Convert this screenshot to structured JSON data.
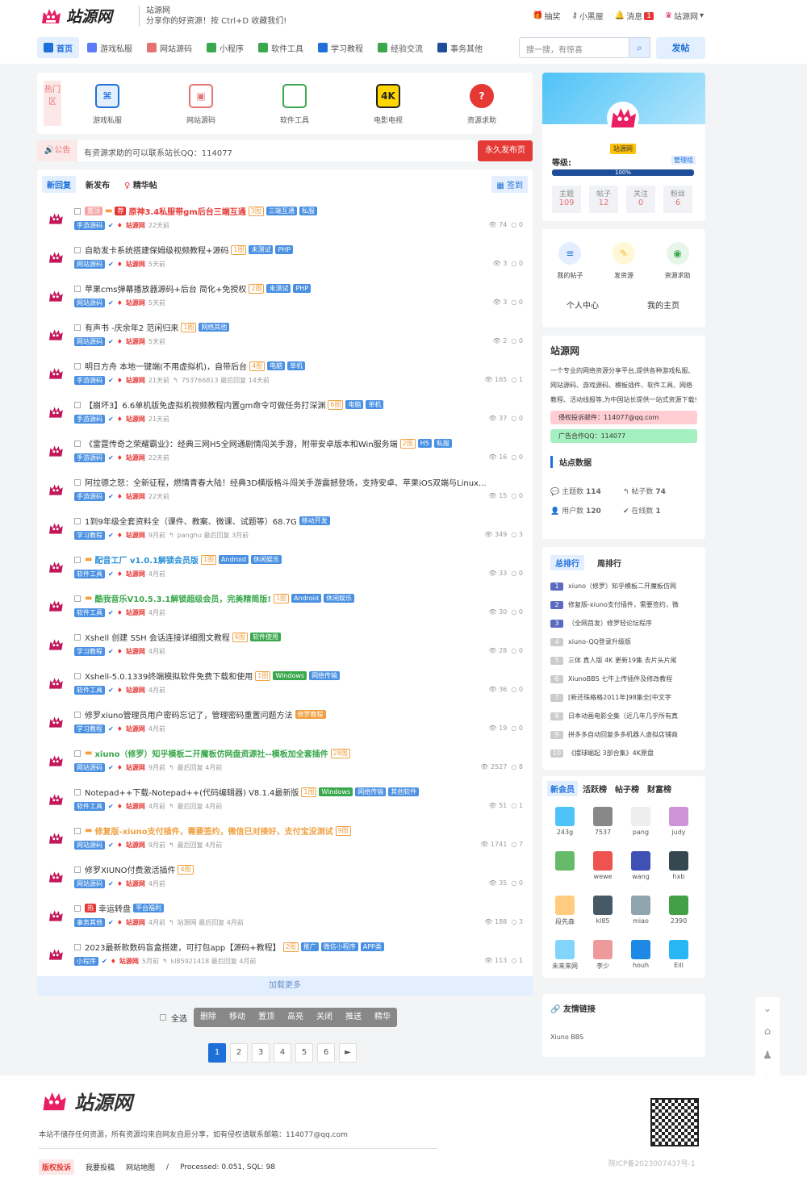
{
  "site": {
    "name": "站源网",
    "sub_name": "站源网",
    "slogan": "分享你的好资源！按 Ctrl+D 收藏我们!"
  },
  "top_links": {
    "lottery": "抽奖",
    "blackroom": "小黑屋",
    "messages": "消息",
    "msg_count": "1",
    "user": "站源网"
  },
  "nav": [
    "首页",
    "游戏私服",
    "网站源码",
    "小程序",
    "软件工具",
    "学习教程",
    "经验交流",
    "事务其他"
  ],
  "search": {
    "placeholder": "搜一搜，有惊喜"
  },
  "post_btn": "发帖",
  "hot": {
    "tag": "热门区",
    "items": [
      {
        "label": "游戏私服",
        "icon": "gamepad-icon"
      },
      {
        "label": "网站源码",
        "icon": "web-code-icon"
      },
      {
        "label": "软件工具",
        "icon": "code-icon"
      },
      {
        "label": "电影电视",
        "icon": "4k-icon"
      },
      {
        "label": "资源求助",
        "icon": "question-icon"
      }
    ]
  },
  "notice": {
    "tag": "公告",
    "text": "有资源求助的可以联系站长QQ：114077",
    "btn": "永久发布页"
  },
  "tabs": [
    "新回复",
    "新发布",
    "精华帖"
  ],
  "signin": "签到",
  "threads": [
    {
      "title": "原神3.4私服带gm后台三端互通",
      "pages": "3图",
      "tags": [
        "三端互通",
        "私服"
      ],
      "cat": "手游源码",
      "author": "站源网",
      "time": "22天前",
      "views": "74",
      "replies": "0",
      "red": true,
      "top": "置顶"
    },
    {
      "title": "自助发卡系统搭建保姆级视频教程+源码",
      "pages": "1图",
      "tags": [
        "未测试",
        "PHP"
      ],
      "cat": "网站源码",
      "author": "站源网",
      "time": "5天前",
      "views": "3",
      "replies": "0"
    },
    {
      "title": "苹果cms弹幕播放器源码+后台 简化+免授权",
      "pages": "2图",
      "tags": [
        "未测试",
        "PHP"
      ],
      "cat": "网站源码",
      "author": "站源网",
      "time": "5天前",
      "views": "3",
      "replies": "0"
    },
    {
      "title": "有声书 -庆余年2 范闲归来",
      "pages": "1图",
      "tags": [
        "网络其他"
      ],
      "cat": "网站源码",
      "author": "站源网",
      "time": "5天前",
      "views": "2",
      "replies": "0"
    },
    {
      "title": "明日方舟 本地一键端(不用虚拟机)，自带后台",
      "pages": "4图",
      "tags": [
        "电脑",
        "单机"
      ],
      "cat": "手游源码",
      "author": "站源网",
      "time": "21天前",
      "extra": "753766813  最后回复 14天前",
      "views": "165",
      "replies": "1"
    },
    {
      "title": "【崩坏3】6.6单机版免虚拟机视频教程内置gm命令可做任务打深渊",
      "pages": "6图",
      "tags": [
        "电脑",
        "单机"
      ],
      "cat": "手游源码",
      "author": "站源网",
      "time": "21天前",
      "views": "37",
      "replies": "0"
    },
    {
      "title": "《雷霆传奇之荣耀霸业》：经典三网H5全网通剧情闯关手游，附带安卓版本和Win服务端",
      "pages": "2图",
      "tags": [
        "H5",
        "私服"
      ],
      "cat": "手游源码",
      "author": "站源网",
      "time": "22天前",
      "views": "16",
      "replies": "0"
    },
    {
      "title": "阿拉德之怒：全新征程，燃情青春大陆！经典3D横版格斗闯关手游震撼登场，支持安卓、苹果iOS双端与Linux...",
      "pages": "",
      "tags": [],
      "cat": "手游源码",
      "author": "站源网",
      "time": "22天前",
      "views": "15",
      "replies": "0"
    },
    {
      "title": "1到9年级全套资料全（课件、教案、微课、试题等）68.7G",
      "pages": "",
      "tags": [
        "移动开发"
      ],
      "cat": "学习教程",
      "author": "站源网",
      "time": "9月前",
      "extra": "panghu  最后回复 3月前",
      "views": "349",
      "replies": "3"
    },
    {
      "title": "配音工厂 v1.0.1解锁会员版",
      "pages": "1图",
      "tags": [
        "Android",
        "休闲娱乐"
      ],
      "cat": "软件工具",
      "author": "站源网",
      "time": "4月前",
      "views": "33",
      "replies": "0",
      "color": "#2b8fd8"
    },
    {
      "title": "酷我音乐V10.5.3.1解锁超级会员，完美精简版!",
      "pages": "1图",
      "tags": [
        "Android",
        "休闲娱乐"
      ],
      "cat": "软件工具",
      "author": "站源网",
      "time": "4月前",
      "views": "30",
      "replies": "0",
      "color": "#3aa84c"
    },
    {
      "title": "Xshell 创建 SSH 会话连接详细图文教程",
      "pages": "6图",
      "tags": [
        "软件使用"
      ],
      "cat": "学习教程",
      "author": "站源网",
      "time": "4月前",
      "views": "28",
      "replies": "0"
    },
    {
      "title": "Xshell-5.0.1339终端模拟软件免费下载和使用",
      "pages": "1图",
      "tags": [
        "Windows",
        "网络传输"
      ],
      "cat": "软件工具",
      "author": "站源网",
      "time": "4月前",
      "views": "36",
      "replies": "0"
    },
    {
      "title": "修罗xiuno管理员用户密码忘记了，管理密码重置问题方法",
      "pages": "",
      "tags": [
        "修罗教程"
      ],
      "cat": "学习教程",
      "author": "站源网",
      "time": "4月前",
      "views": "19",
      "replies": "0"
    },
    {
      "title": "xiuno（修罗）知乎模板二开魔板仿网盘资源社--模板加全套插件",
      "pages": "28图",
      "tags": [],
      "cat": "网站源码",
      "author": "站源网",
      "time": "9月前",
      "extra": "最后回复 4月前",
      "views": "2527",
      "replies": "8",
      "color": "#3aa84c"
    },
    {
      "title": "Notepad++下载-Notepad++(代码编辑器) V8.1.4最新版",
      "pages": "1图",
      "tags": [
        "Windows",
        "网络传输",
        "其他软件"
      ],
      "cat": "软件工具",
      "author": "站源网",
      "time": "4月前",
      "extra": "最后回复 4月前",
      "views": "51",
      "replies": "1"
    },
    {
      "title": "修复版-xiuno支付插件，需要签约，微信已对接好，支付宝没测试",
      "pages": "9图",
      "tags": [],
      "cat": "网站源码",
      "author": "站源网",
      "time": "9月前",
      "extra": "最后回复 4月前",
      "views": "1741",
      "replies": "7",
      "color": "#f0a040"
    },
    {
      "title": "修罗XIUNO付费激活插件",
      "pages": "4图",
      "tags": [],
      "cat": "网站源码",
      "author": "站源网",
      "time": "4月前",
      "views": "35",
      "replies": "0"
    },
    {
      "title": "幸运转盘",
      "pages": "",
      "tags": [
        "平台福利"
      ],
      "cat": "事务其他",
      "author": "站源网",
      "time": "4月前",
      "extra": "站源网  最后回复 4月前",
      "views": "188",
      "replies": "3",
      "hot": "热"
    },
    {
      "title": "2023最新款数码盲盒搭建，可打包app【源码+教程】",
      "pages": "2图",
      "tags": [
        "推广",
        "微信小程序",
        "APP类"
      ],
      "cat": "小程序",
      "author": "站源网",
      "time": "5月前",
      "extra": "kl85921418  最后回复 4月前",
      "views": "113",
      "replies": "1"
    }
  ],
  "load_more": "加载更多",
  "admin": {
    "select_all": "全选",
    "actions": [
      "删除",
      "移动",
      "置顶",
      "高亮",
      "关闭",
      "推送",
      "精华"
    ]
  },
  "pager": [
    "1",
    "2",
    "3",
    "4",
    "5",
    "6",
    "►"
  ],
  "profile": {
    "badge": "站源网",
    "level_label": "等级:",
    "group": "管理组",
    "progress": "100%",
    "progress_value": 1.0,
    "stats": [
      {
        "label": "主题",
        "value": "109"
      },
      {
        "label": "帖子",
        "value": "12"
      },
      {
        "label": "关注",
        "value": "0"
      },
      {
        "label": "粉丝",
        "value": "6"
      }
    ]
  },
  "quick": {
    "items": [
      "我的帖子",
      "发资源",
      "资源求助"
    ],
    "center": "个人中心",
    "home": "我的主页"
  },
  "about": {
    "title": "站源网",
    "desc": "一个专业的网络资源分享平台,提供各种游戏私服、网站源码、游戏源码、模板插件、软件工具、网络教程、活动线报等,为中国站长提供一站式资源下载!",
    "mail": "侵权投诉邮件：114077@qq.com",
    "qq": "广告合作QQ：114077",
    "data_title": "站点数据",
    "topics": "主题数",
    "topics_v": "114",
    "posts": "帖子数",
    "posts_v": "74",
    "users": "用户数",
    "users_v": "120",
    "online": "在线数",
    "online_v": "1"
  },
  "rank": {
    "tabs": [
      "总排行",
      "周排行"
    ],
    "items": [
      "xiuno（修罗）知乎模板二开魔板仿网",
      "修复版-xiuno支付插件，需要签约，微",
      "（全网首发）修罗轻论坛程序",
      "xiuno-QQ登录升级版",
      "三体 真人版 4K 更新19集 去片头片尾",
      "XiunoBBS 七牛上传插件及修改教程",
      "[新还珠格格2011年]98集全[中文字",
      "日本动画电影全集（近几年几乎所有真",
      "拼多多自动回复多多机器人虚拟店铺商",
      "《摆球崛起 3部合集》4K原盘"
    ]
  },
  "members": {
    "tabs": [
      "新会员",
      "活跃榜",
      "帖子榜",
      "财富榜"
    ],
    "names": [
      "243g",
      "7537",
      "pang",
      "judy",
      "",
      "wewe",
      "wang",
      "hxb",
      "段先森",
      "kl85",
      "miao",
      "2390",
      "未来来网",
      "李少",
      "houh",
      "Eill"
    ]
  },
  "links": {
    "title": "友情链接",
    "item": "Xiuno BBS"
  },
  "footer": {
    "notice": "本站不储存任何资源，所有资源均来自网友自愿分享，如有侵权请联系邮箱：114077@qq.com",
    "links": [
      "版权投诉",
      "我要投稿",
      "网站地图",
      "/"
    ],
    "processed": "Processed: 0.051, SQL: 98",
    "icp": "陕ICP备2023007437号-1"
  }
}
